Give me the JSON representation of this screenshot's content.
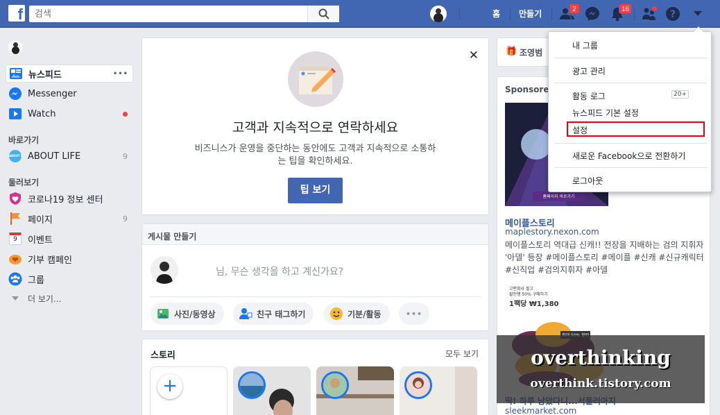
{
  "topbar": {
    "logo": "f",
    "search_placeholder": "검색",
    "links": {
      "home": "홈",
      "create": "만들기"
    },
    "friend_badge": "2",
    "notif_badge": "16"
  },
  "left_nav": {
    "items": [
      {
        "label": "뉴스피드",
        "dots": "•••"
      },
      {
        "label": "Messenger"
      },
      {
        "label": "Watch"
      }
    ],
    "shortcuts_heading": "바로가기",
    "shortcuts": [
      {
        "label": "ABOUT LIFE",
        "count": "9",
        "icon_text": "ABOUT LIFE"
      }
    ],
    "explore_heading": "둘러보기",
    "explore": [
      {
        "label": "코로나19 정보 센터"
      },
      {
        "label": "페이지",
        "count": "9"
      },
      {
        "label": "이벤트",
        "icon_text": "9"
      },
      {
        "label": "기부 캠페인"
      },
      {
        "label": "그룹"
      }
    ],
    "more": "더 보기..."
  },
  "promo": {
    "title": "고객과 지속적으로 연락하세요",
    "body_line1": "비즈니스가 운영을 중단하는 동안에도 고객과 지속적으로 소통하",
    "body_line2": "는 팁을 확인하세요.",
    "button": "팁 보기",
    "close": "✕"
  },
  "composer": {
    "header": "게시물 만들기",
    "placeholder": "님, 무슨 생각을 하고 계신가요?",
    "actions": [
      "사진/동영상",
      "친구 태그하기",
      "기분/활동"
    ],
    "more": "•••"
  },
  "stories": {
    "header": "스토리",
    "see_all": "모두 보기",
    "add": "+"
  },
  "right": {
    "birthday_name": "조영범",
    "sponsored": "Sponsored",
    "ad1": {
      "img_text": "홈페이지 바로가기",
      "title": "메이플스토리",
      "url": "maplestory.nexon.com",
      "desc": "메이플스토리 역대급 신캐!! 전장을 지배하는 검의 지휘자 '아델' 등장 #메이플스토리 #메이플 #신캐 #신규캐릭터 #신직업 #검의지휘자 #아델"
    },
    "ad2": {
      "img_line1": "고편회사 필고",
      "img_line2": "할인행 50% 구매하기",
      "img_price": "1팩당 ₩1,380",
      "img_badge": "최대 50% 할인",
      "title": "딱! 하루 남았다니...서둘러아지",
      "url": "sleekmarket.com"
    }
  },
  "dropdown": {
    "items": [
      "내 그룹",
      "광고 관리",
      "활동 로그",
      "뉴스피드 기본 설정",
      "설정",
      "새로운 Facebook으로 전환하기",
      "로그아웃"
    ],
    "activity_badge": "20+"
  },
  "watermark": {
    "line1": "overthinking",
    "line2": "overthink.tistory.com"
  },
  "colors": {
    "brand": "#4267b2",
    "background": "#e9ebee",
    "notification": "#fa3e3e",
    "highlight": "#e00000"
  }
}
